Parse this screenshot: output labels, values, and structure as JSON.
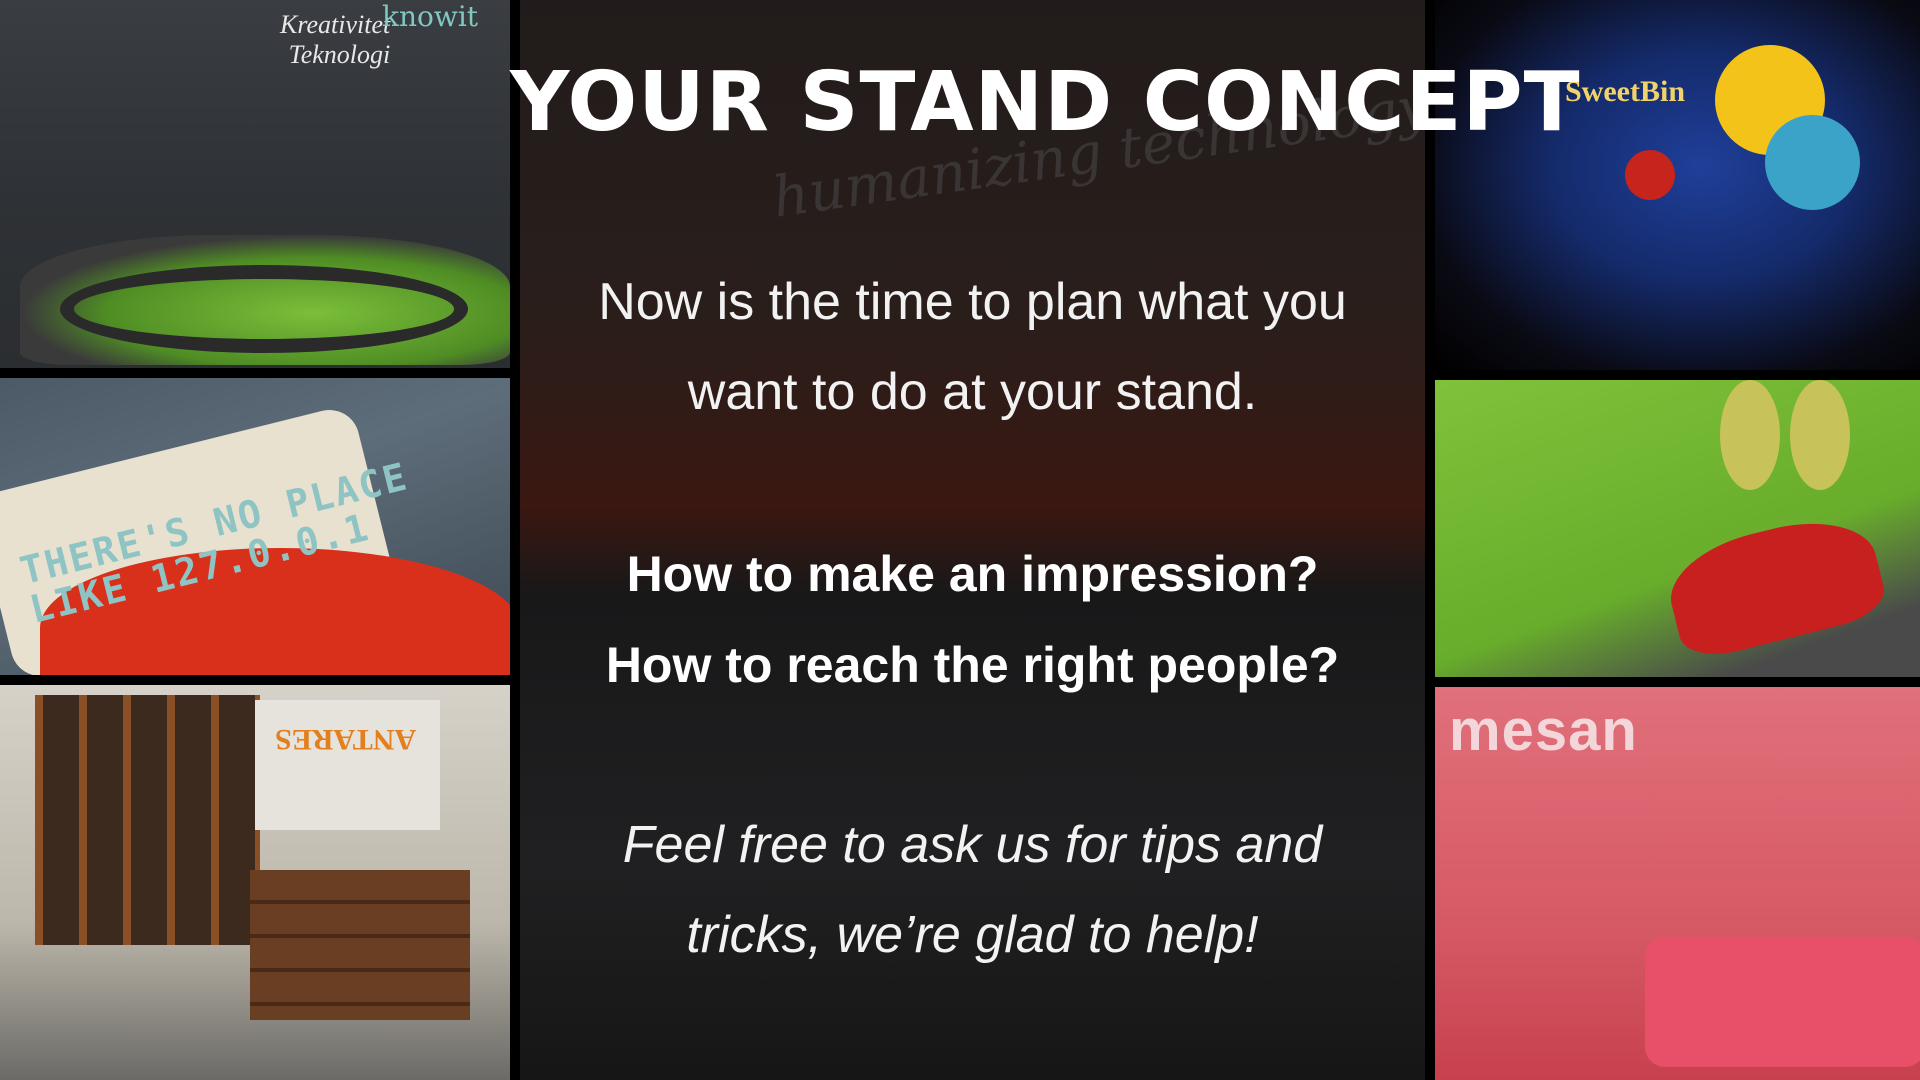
{
  "slide": {
    "title": "YOUR STAND CONCEPT",
    "intro_lines": [
      "Now is the time to plan what you",
      "want to do at your stand."
    ],
    "questions": [
      "How to make an impression?",
      "How to reach the right people?"
    ],
    "closing_lines": [
      "Feel free to ask us for tips and",
      "tricks, we’re glad to help!"
    ]
  },
  "photos": {
    "knowit": {
      "brand": "knowit",
      "words": [
        "Kreativitet",
        "Teknologi"
      ]
    },
    "pillow": {
      "stitch_lines": [
        "THERE'S NO PLACE",
        "LIKE 127.0.0.1"
      ]
    },
    "antares": {
      "poster": "ANTARES"
    },
    "center": {
      "wall": "humanizing technology"
    },
    "sweetbin": {
      "logo": "SweetBin"
    },
    "mesan": {
      "logo": "mesan"
    }
  }
}
